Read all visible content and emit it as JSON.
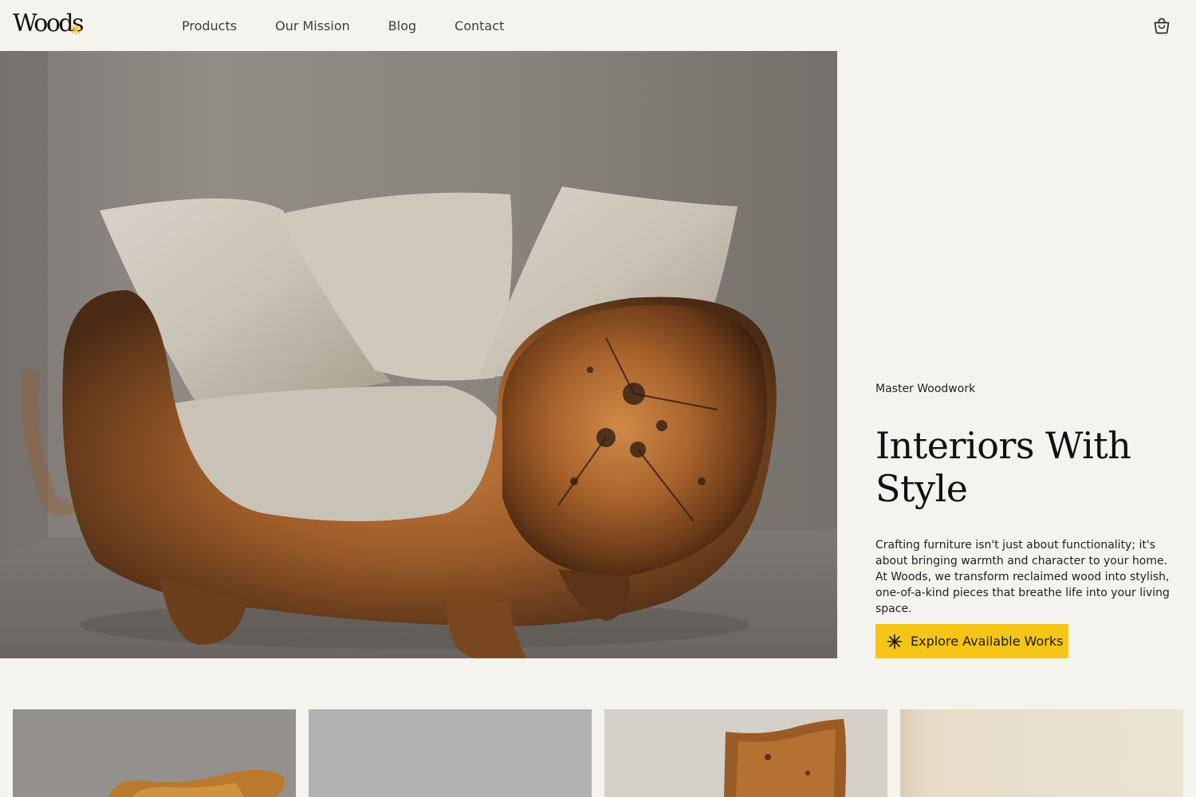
{
  "header": {
    "logo_text": "Woods",
    "nav": [
      {
        "label": "Products"
      },
      {
        "label": "Our Mission"
      },
      {
        "label": "Blog"
      },
      {
        "label": "Contact"
      }
    ],
    "cart_icon": "shopping-bag-icon"
  },
  "hero": {
    "image": "wooden-armchair-with-linen-cushions",
    "eyebrow": "Master Woodwork",
    "headline": "Interiors With Style",
    "description": "Crafting furniture isn't just about functionality; it's about bringing warmth and character to your home. At Woods, we transform reclaimed wood into stylish, one-of-a-kind pieces that breathe life into your living space.",
    "cta": {
      "label": "Explore Available Works",
      "icon": "asterisk-icon"
    }
  },
  "products": [
    {
      "image": "carved-wooden-chair-photo"
    },
    {
      "image": "grey-background-product-photo"
    },
    {
      "image": "wooden-chair-back-photo"
    },
    {
      "image": "cream-wall-product-photo"
    }
  ],
  "colors": {
    "background": "#f5f3ee",
    "accent": "#f5c518",
    "text": "#1e1e1e"
  }
}
